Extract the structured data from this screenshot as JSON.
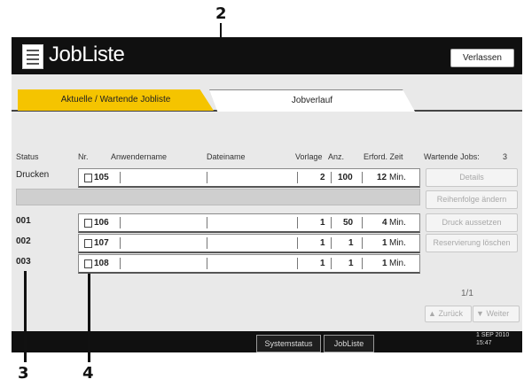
{
  "callouts": {
    "c2": "2",
    "c3": "3",
    "c4": "4"
  },
  "window": {
    "title": "JobListe",
    "exit_label": "Verlassen"
  },
  "tabs": [
    {
      "label": "Aktuelle / Wartende Jobliste",
      "active": true
    },
    {
      "label": "Jobverlauf",
      "active": false
    }
  ],
  "columns": {
    "status": "Status",
    "nr": "Nr.",
    "user": "Anwendername",
    "file": "Dateiname",
    "pages": "Vorlage",
    "qty": "Anz.",
    "time": "Erford. Zeit",
    "waiting": "Wartende Jobs:",
    "waiting_count": "3"
  },
  "printing_row": {
    "status": "Drucken",
    "nr": "105",
    "pages": "2",
    "qty": "100",
    "time": "12",
    "unit": "Min."
  },
  "queue_rows": [
    {
      "status": "001",
      "nr": "106",
      "pages": "1",
      "qty": "50",
      "time": "4",
      "unit": "Min."
    },
    {
      "status": "002",
      "nr": "107",
      "pages": "1",
      "qty": "1",
      "time": "1",
      "unit": "Min."
    },
    {
      "status": "003",
      "nr": "108",
      "pages": "1",
      "qty": "1",
      "time": "1",
      "unit": "Min."
    }
  ],
  "side_buttons": [
    "Details",
    "Reihenfolge ändern",
    "Druck aussetzen",
    "Reservierung löschen"
  ],
  "pager": {
    "page": "1/1",
    "prev": "Zurück",
    "next": "Weiter"
  },
  "bottom_bar": {
    "status_label": "Systemstatus",
    "joblist_label": "JobListe",
    "clock_line1": "1 SEP 2010",
    "clock_line2": "15:47"
  },
  "colors": {
    "active_tab": "#f5c400",
    "title_bar": "#101010"
  }
}
